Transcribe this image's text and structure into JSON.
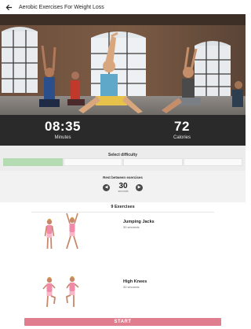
{
  "app_bar": {
    "title": "Aerobic Exercises For Weight Loss",
    "back_icon": "arrow-left-icon"
  },
  "hero": {
    "image": "group doing yoga lunge pose with arms raised in loft studio"
  },
  "stats": {
    "duration_value": "08:35",
    "duration_label": "Minutes",
    "calories_value": "72",
    "calories_label": "Calories"
  },
  "difficulty": {
    "label": "Select difficulty",
    "levels": 4,
    "selected_level": 1
  },
  "rest": {
    "label": "Rest between exercises",
    "value": "30",
    "unit": "seconds",
    "minus_icon": "chevron-left-icon",
    "plus_icon": "chevron-right-icon"
  },
  "exercises": {
    "count_label": "9 Exercises",
    "items": [
      {
        "name": "Jumping Jacks",
        "duration": "30 seconds"
      },
      {
        "name": "High Knees",
        "duration": "30 seconds"
      }
    ]
  },
  "footer": {
    "start_label": "START"
  },
  "colors": {
    "accent": "#e07d8e",
    "stats_bg": "#2a2a2a",
    "difficulty_active": "#b5dbb3"
  }
}
